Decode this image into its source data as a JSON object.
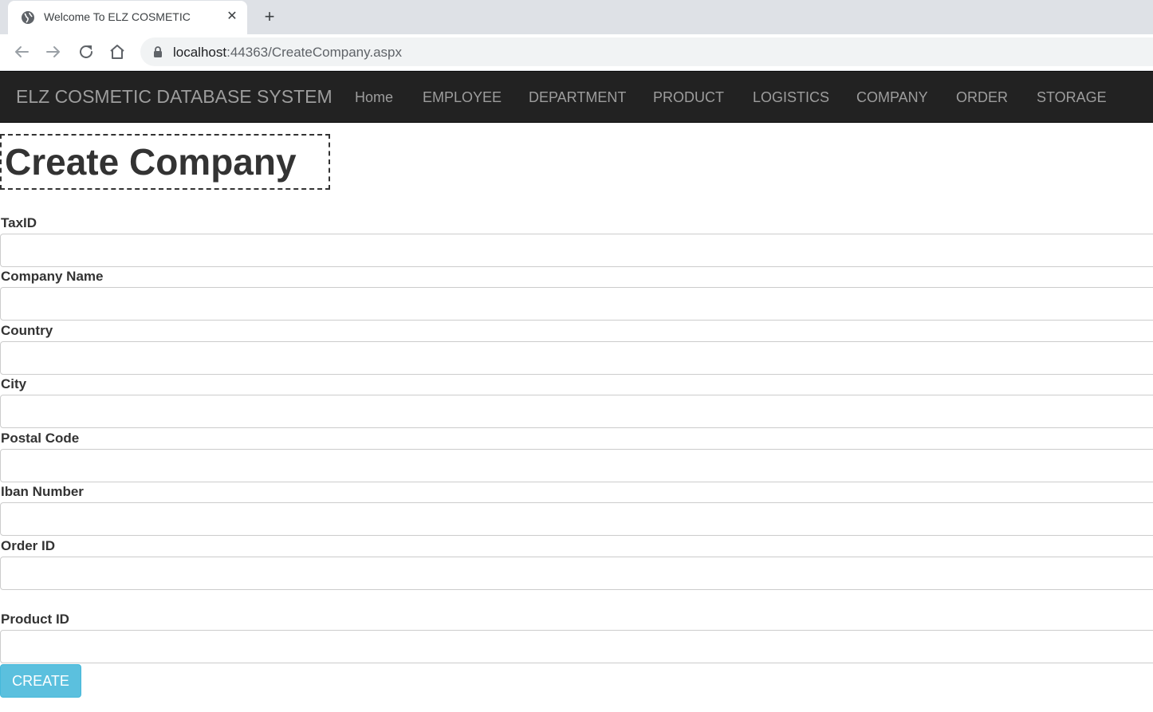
{
  "browser": {
    "tab_title": "Welcome To ELZ COSMETIC",
    "tab_close": "✕",
    "new_tab": "+",
    "url_host": "localhost",
    "url_path": ":44363/CreateCompany.aspx"
  },
  "navbar": {
    "brand": "ELZ COSMETIC DATABASE SYSTEM",
    "items": [
      {
        "label": "Home"
      },
      {
        "label": "EMPLOYEE"
      },
      {
        "label": "DEPARTMENT"
      },
      {
        "label": "PRODUCT"
      },
      {
        "label": "LOGISTICS"
      },
      {
        "label": "COMPANY"
      },
      {
        "label": "ORDER"
      },
      {
        "label": "STORAGE"
      }
    ]
  },
  "page": {
    "title": "Create Company"
  },
  "form": {
    "fields": [
      {
        "label": "TaxID",
        "value": ""
      },
      {
        "label": "Company Name",
        "value": ""
      },
      {
        "label": "Country",
        "value": ""
      },
      {
        "label": "City",
        "value": ""
      },
      {
        "label": "Postal Code",
        "value": ""
      },
      {
        "label": "Iban Number",
        "value": ""
      },
      {
        "label": "Order ID",
        "value": ""
      },
      {
        "label": "Product ID",
        "value": ""
      }
    ],
    "submit_label": "CREATE"
  },
  "colors": {
    "navbar_bg": "#222222",
    "nav_text": "#9d9d9d",
    "button_bg": "#5bc0de"
  }
}
